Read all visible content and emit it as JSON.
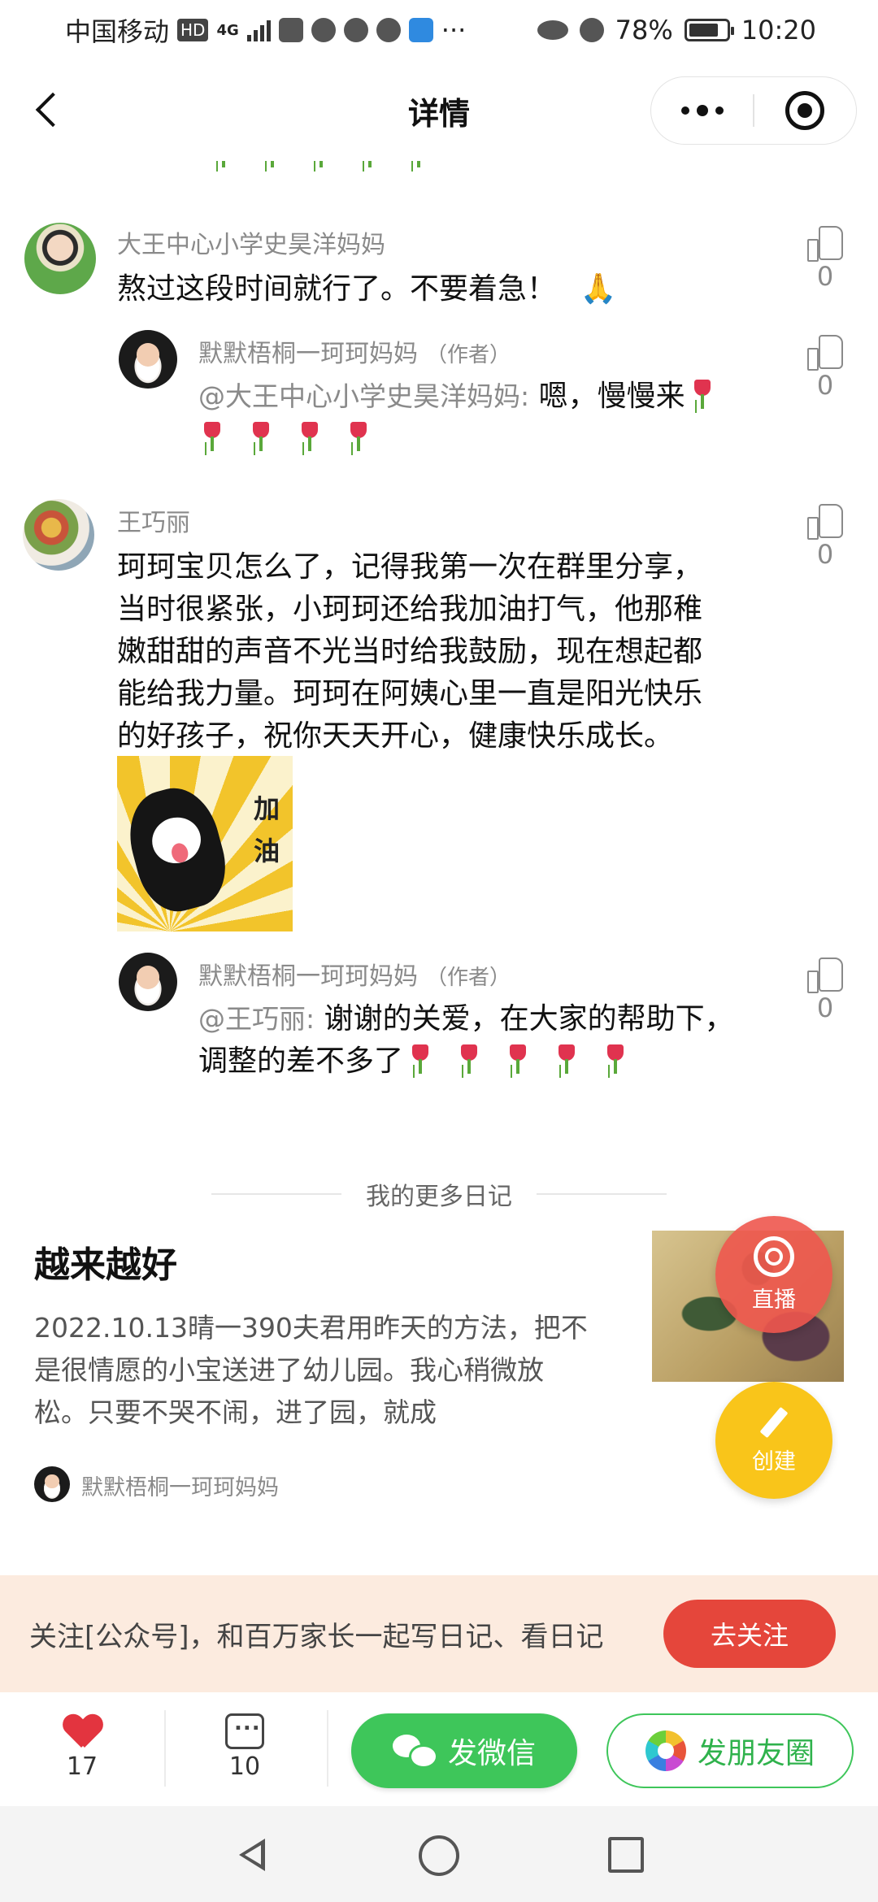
{
  "status_bar": {
    "carrier": "中国移动",
    "hd_badge": "HD",
    "network": "4G",
    "battery": "78%",
    "time": "10:20"
  },
  "header": {
    "title": "详情"
  },
  "comments": [
    {
      "author": "大王中心小学史昊洋妈妈",
      "text": "熬过这段时间就行了。不要着急！",
      "emoji": "🙏",
      "likes": "0",
      "reply": {
        "author": "默默梧桐一珂珂妈妈",
        "author_tag": "（作者）",
        "mention": "@大王中心小学史昊洋妈妈:",
        "text": "嗯，慢慢来",
        "likes": "0"
      }
    },
    {
      "author": "王巧丽",
      "text_lines": [
        "珂珂宝贝怎么了，记得我第一次在群里分享，",
        "当时很紧张，小珂珂还给我加油打气，他那稚",
        "嫩甜甜的声音不光当时给我鼓励，现在想起都",
        "能给我力量。珂珂在阿姨心里一直是阳光快乐",
        "的好孩子，祝你天天开心，健康快乐成长。"
      ],
      "sticker_text": [
        "加",
        "油"
      ],
      "likes": "0",
      "reply": {
        "author": "默默梧桐一珂珂妈妈",
        "author_tag": "（作者）",
        "mention": "@王巧丽:",
        "text_line1": "谢谢的关爱，在大家的帮助下，",
        "text_line2": "调整的差不多了",
        "likes": "0"
      }
    }
  ],
  "more_diaries": {
    "section_label": "我的更多日记",
    "title": "越来越好",
    "excerpt_lines": [
      "2022.10.13晴一390夫君用昨天的方法，把不",
      "是很情愿的小宝送进了幼儿园。我心稍微放",
      "松。只要不哭不闹，进了园，就成"
    ],
    "author": "默默梧桐一珂珂妈妈"
  },
  "fabs": {
    "live": "直播",
    "create": "创建"
  },
  "follow_banner": {
    "text": "关注[公众号]，和百万家长一起写日记、看日记",
    "button": "去关注"
  },
  "action_bar": {
    "likes": "17",
    "comments": "10",
    "wechat_button": "发微信",
    "moments_button": "发朋友圈"
  },
  "colors": {
    "like_red": "#e3343f",
    "wechat_green": "#3ec65a",
    "follow_red": "#e5463b",
    "banner_bg": "#fcebdf",
    "live_fab": "#ee564e",
    "create_fab": "#f9c51a"
  }
}
